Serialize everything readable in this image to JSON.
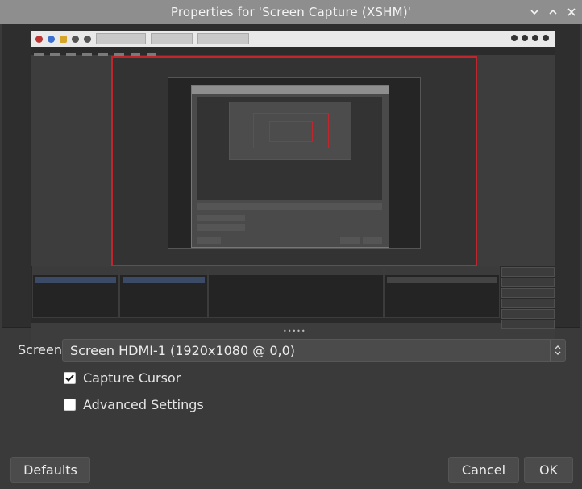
{
  "window": {
    "title": "Properties for 'Screen Capture (XSHM)'",
    "controls": [
      "chevron-down-icon",
      "chevron-up-icon",
      "close-icon"
    ]
  },
  "preview": {
    "description_free": true
  },
  "form": {
    "screen_label": "Screen",
    "screen_value": "Screen HDMI-1 (1920x1080 @ 0,0)",
    "capture_cursor_label": "Capture Cursor",
    "capture_cursor_checked": true,
    "advanced_label": "Advanced Settings",
    "advanced_checked": false
  },
  "buttons": {
    "defaults": "Defaults",
    "cancel": "Cancel",
    "ok": "OK"
  },
  "colors": {
    "titlebar": "#8e8e8e",
    "background": "#3a3a3a",
    "capture_border": "#c0272d"
  }
}
